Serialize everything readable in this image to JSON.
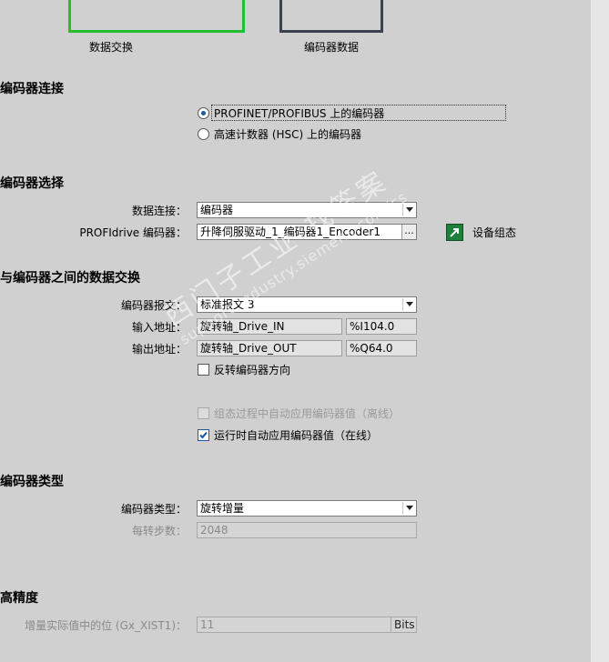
{
  "top_boxes": {
    "left_caption": "数据交换",
    "right_caption": "编码器数据"
  },
  "sections": {
    "encoder_connection": "编码器连接",
    "encoder_selection": "编码器选择",
    "data_exchange": "与编码器之间的数据交换",
    "encoder_type": "编码器类型",
    "high_precision": "高精度"
  },
  "connection": {
    "option1": "PROFINET/PROFIBUS 上的编码器",
    "option2": "高速计数器 (HSC) 上的编码器"
  },
  "selection": {
    "data_connection_label": "数据连接：",
    "data_connection_value": "编码器",
    "profidrive_label": "PROFIdrive 编码器：",
    "profidrive_value": "升降伺服驱动_1_编码器1_Encoder1",
    "browse_label": "...",
    "device_config_label": "设备组态"
  },
  "exchange": {
    "telegram_label": "编码器报文：",
    "telegram_value": "标准报文 3",
    "input_label": "输入地址：",
    "input_tag": "旋转轴_Drive_IN",
    "input_address": "%I104.0",
    "output_label": "输出地址：",
    "output_tag": "旋转轴_Drive_OUT",
    "output_address": "%Q64.0",
    "invert_label": "反转编码器方向",
    "auto_offline_label": "组态过程中自动应用编码器值（离线）",
    "auto_online_label": "运行时自动应用编码器值（在线）"
  },
  "type": {
    "encoder_type_label": "编码器类型：",
    "encoder_type_value": "旋转增量",
    "steps_label": "每转步数：",
    "steps_value": "2048"
  },
  "precision": {
    "bits_label": "增量实际值中的位 (Gx_XIST1)：",
    "bits_value": "11",
    "bits_unit": "Bits"
  },
  "watermark": {
    "text_big": "西门子工业 找答案",
    "text_small": "support.industry.siemens.com/cs"
  },
  "colors": {
    "background": "#d0d0d0",
    "active_box_border": "#22c02e",
    "inactive_box_border": "#3b4150",
    "checkbox_accent": "#1a5aa8",
    "device_config_icon": "#1e7f3a"
  }
}
